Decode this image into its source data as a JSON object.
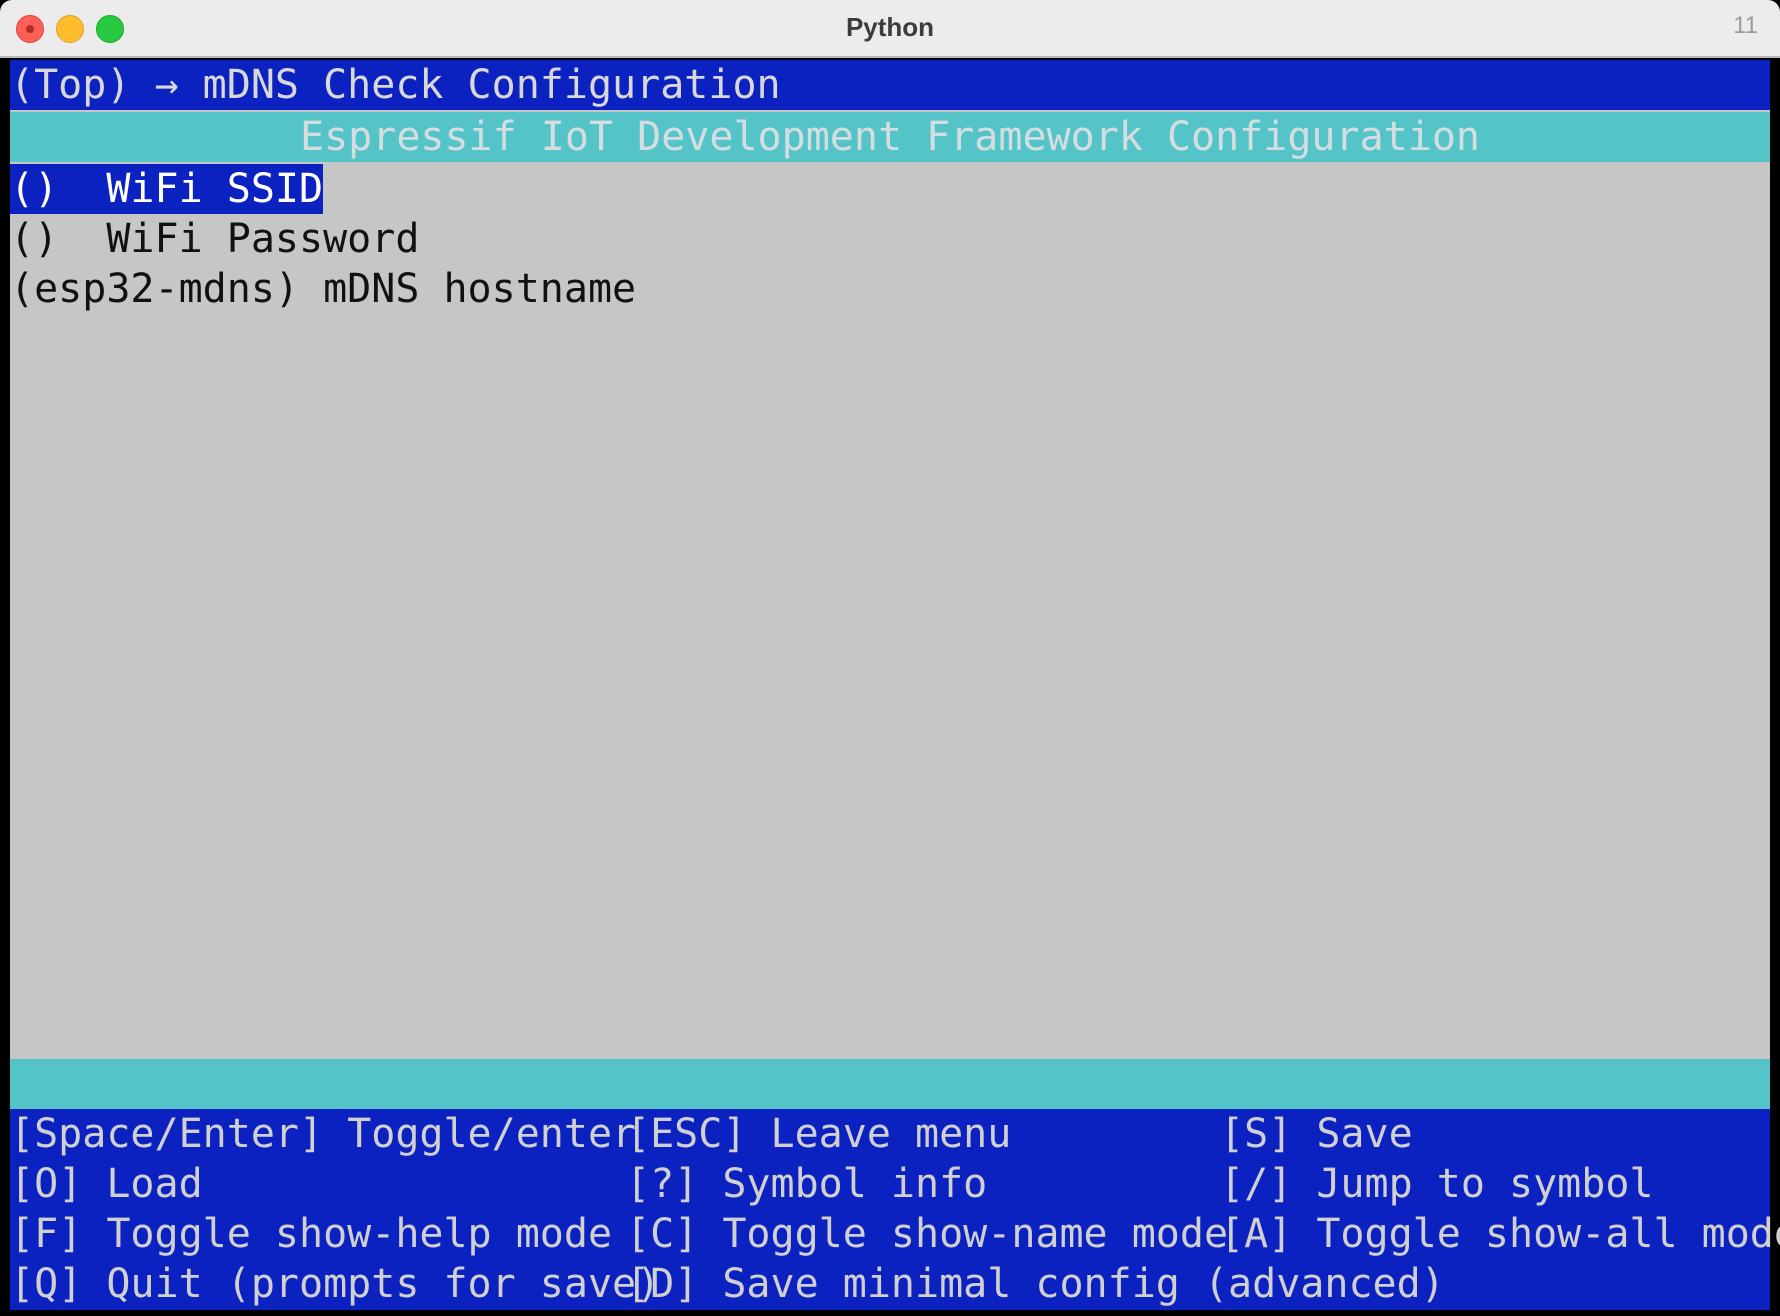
{
  "window": {
    "title": "Python",
    "badge": "11"
  },
  "terminal": {
    "breadcrumb": "(Top) → mDNS Check Configuration",
    "header": "Espressif IoT Development Framework Configuration",
    "items": [
      {
        "text": "()  WiFi SSID",
        "selected": true
      },
      {
        "text": "()  WiFi Password",
        "selected": false
      },
      {
        "text": "(esp32-mdns) mDNS hostname",
        "selected": false
      }
    ],
    "help": [
      [
        "[Space/Enter] Toggle/enter",
        "[ESC] Leave menu",
        "[S] Save"
      ],
      [
        "[O] Load",
        "[?] Symbol info",
        "[/] Jump to symbol"
      ],
      [
        "[F] Toggle show-help mode",
        "[C] Toggle show-name mode",
        "[A] Toggle show-all mode"
      ],
      [
        "[Q] Quit (prompts for save)",
        "[D] Save minimal config (advanced)",
        ""
      ]
    ]
  },
  "colors": {
    "blue": "#0b22c0",
    "cyan": "#55c4c8",
    "gray": "#c6c6c6"
  }
}
